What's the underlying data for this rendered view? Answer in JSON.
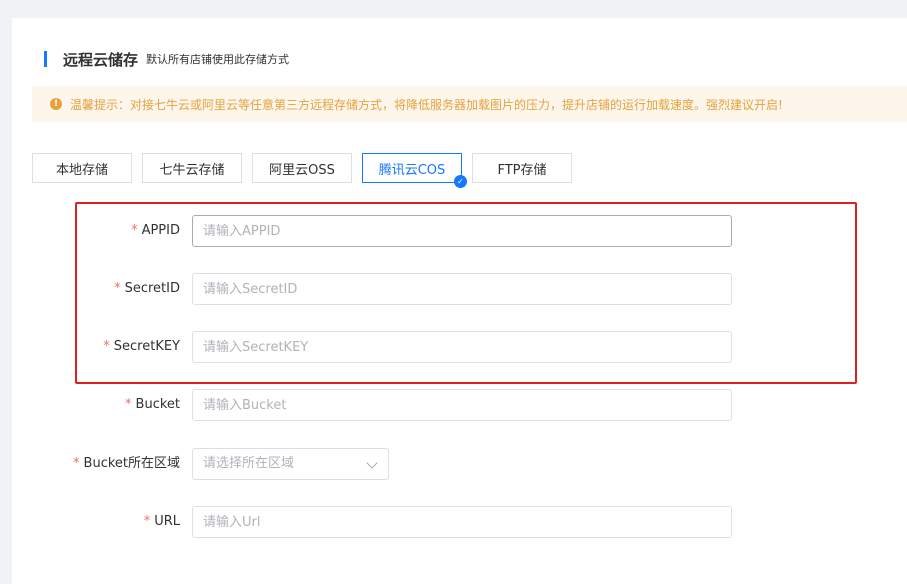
{
  "header": {
    "title": "远程云储存",
    "subtitle": "默认所有店铺使用此存储方式"
  },
  "tip": {
    "icon": "warning-icon",
    "text": "温馨提示：对接七牛云或阿里云等任意第三方远程存储方式，将降低服务器加载图片的压力，提升店铺的运行加载速度。强烈建议开启!"
  },
  "tabs": [
    {
      "label": "本地存储",
      "active": false
    },
    {
      "label": "七牛云存储",
      "active": false
    },
    {
      "label": "阿里云OSS",
      "active": false
    },
    {
      "label": "腾讯云COS",
      "active": true
    },
    {
      "label": "FTP存储",
      "active": false
    }
  ],
  "form": {
    "required_mark": "*",
    "appid": {
      "label": "APPID",
      "value": "",
      "placeholder": "请输入APPID"
    },
    "secret_id": {
      "label": "SecretID",
      "value": "",
      "placeholder": "请输入SecretID"
    },
    "secret_key": {
      "label": "SecretKEY",
      "value": "",
      "placeholder": "请输入SecretKEY"
    },
    "bucket": {
      "label": "Bucket",
      "value": "",
      "placeholder": "请输入Bucket"
    },
    "region": {
      "label": "Bucket所在区域",
      "placeholder": "请选择所在区域"
    },
    "url": {
      "label": "URL",
      "value": "",
      "placeholder": "请输入Url"
    }
  },
  "colors": {
    "accent": "#1677ff",
    "warning": "#e6a23c",
    "required": "#f56c6c",
    "highlight": "#e02020"
  }
}
